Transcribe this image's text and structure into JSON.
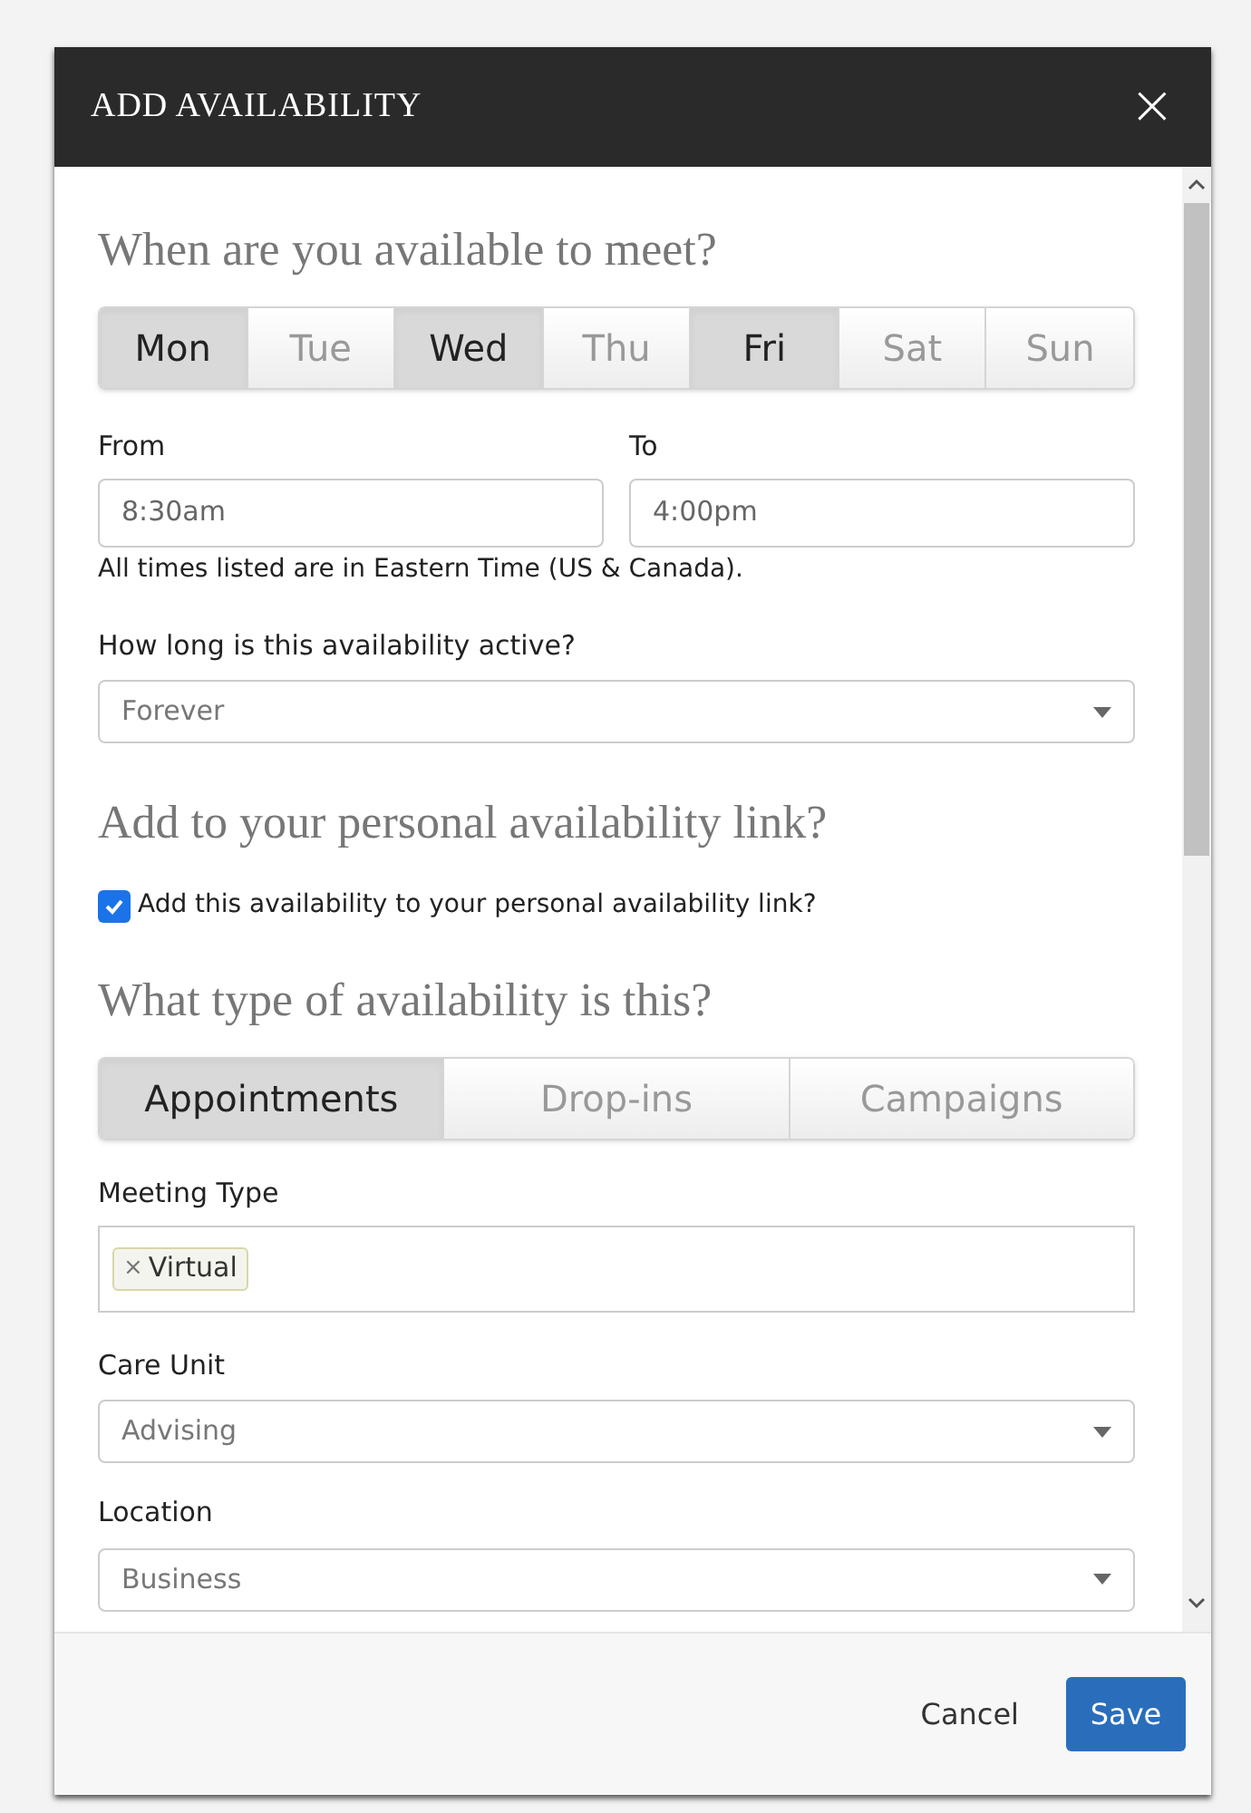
{
  "dialog": {
    "title": "ADD AVAILABILITY",
    "close": "×"
  },
  "when": {
    "heading": "When are you available to meet?",
    "days": [
      {
        "label": "Mon",
        "selected": true
      },
      {
        "label": "Tue",
        "selected": false
      },
      {
        "label": "Wed",
        "selected": true
      },
      {
        "label": "Thu",
        "selected": false
      },
      {
        "label": "Fri",
        "selected": true
      },
      {
        "label": "Sat",
        "selected": false
      },
      {
        "label": "Sun",
        "selected": false
      }
    ],
    "from": {
      "label": "From",
      "value": "8:30am"
    },
    "to": {
      "label": "To",
      "value": "4:00pm"
    },
    "timezone_note": "All times listed are in Eastern Time (US & Canada).",
    "duration": {
      "label": "How long is this availability active?",
      "value": "Forever"
    }
  },
  "link": {
    "heading": "Add to your personal availability link?",
    "checkbox": {
      "label": "Add this availability to your personal availability link?",
      "checked": true
    }
  },
  "type": {
    "heading": "What type of availability is this?",
    "options": [
      {
        "label": "Appointments",
        "selected": true
      },
      {
        "label": "Drop-ins",
        "selected": false
      },
      {
        "label": "Campaigns",
        "selected": false
      }
    ],
    "meeting_type": {
      "label": "Meeting Type",
      "tags": [
        {
          "remove": "×",
          "label": "Virtual"
        }
      ]
    },
    "care_unit": {
      "label": "Care Unit",
      "value": "Advising"
    },
    "location": {
      "label": "Location",
      "value": "Business"
    }
  },
  "footer": {
    "cancel": "Cancel",
    "save": "Save"
  }
}
